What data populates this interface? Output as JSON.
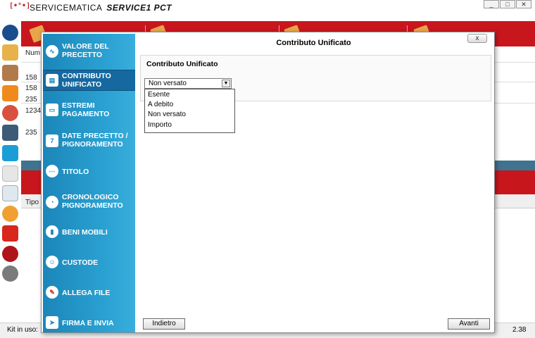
{
  "app": {
    "logo_text": "[•°•]",
    "name": "SERVICEMATICA",
    "product": "SERVICE1 PCT",
    "version": "2.38"
  },
  "window_controls": {
    "minimize": "_",
    "maximize": "□",
    "close": "✕"
  },
  "background": {
    "column_num": "Num",
    "rows": [
      "158",
      "158",
      "235",
      "1234",
      "235"
    ],
    "column_tipo": "Tipo",
    "status_kit_label": "Kit in uso:"
  },
  "modal": {
    "title": "Contributo Unificato",
    "close_label": "x",
    "nav_items": [
      {
        "label": "VALORE DEL PRECETTO",
        "icon": "chart-line-icon"
      },
      {
        "label": "CONTRIBUTO UNIFICATO",
        "icon": "receipt-icon"
      },
      {
        "label": "ESTREMI PAGAMENTO",
        "icon": "card-icon"
      },
      {
        "label": "DATE PRECETTO / PIGNORAMENTO",
        "icon": "calendar-icon"
      },
      {
        "label": "TITOLO",
        "icon": "dots-icon"
      },
      {
        "label": "CRONOLOGICO PIGNORAMENTO",
        "icon": "pie-chart-icon"
      },
      {
        "label": "BENI MOBILI",
        "icon": "door-icon"
      },
      {
        "label": "CUSTODE",
        "icon": "person-icon"
      },
      {
        "label": "ALLEGA FILE",
        "icon": "pin-icon"
      },
      {
        "label": "FIRMA E INVIA",
        "icon": "send-icon"
      }
    ],
    "active_nav": "CONTRIBUTO UNIFICATO",
    "panel_title": "Contributo Unificato",
    "select_value": "Non versato",
    "options": [
      "Esente",
      "A debito",
      "Non versato",
      "Importo"
    ],
    "back_label": "Indietro",
    "next_label": "Avanti"
  },
  "colors": {
    "brand_red": "#c8161d",
    "nav_blue": "#1b86b9",
    "nav_active": "#1569a0"
  }
}
